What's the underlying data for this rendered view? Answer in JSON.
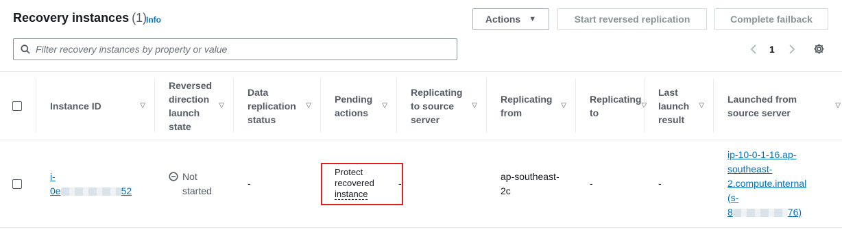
{
  "header": {
    "title": "Recovery instances",
    "count": "(1)",
    "info": "Info",
    "actions_label": "Actions",
    "reverse_label": "Start reversed replication",
    "failback_label": "Complete failback"
  },
  "search": {
    "placeholder": "Filter recovery instances by property or value"
  },
  "pagination": {
    "current_page": "1"
  },
  "table": {
    "columns": [
      "Instance ID",
      "Reversed direction launch state",
      "Data replication status",
      "Pending actions",
      "Replicating to source server",
      "Replicating from",
      "Replicating to",
      "Last launch result",
      "Launched from source server"
    ],
    "rows": [
      {
        "instance_id_prefix": "i-",
        "instance_id_start": "0e",
        "instance_id_end": "52",
        "reversed_state": "Not started",
        "data_replication_status": "-",
        "pending_actions": "Protect recovered instance",
        "pending_actions_line1": "Protect",
        "pending_actions_line2": "recovered",
        "pending_actions_line3": "instance",
        "replicating_to_source": "-",
        "replicating_from": "ap-southeast-2c",
        "replicating_from_line1": "ap-southeast-",
        "replicating_from_line2": "2c",
        "replicating_to": "-",
        "last_launch_result": "-",
        "launched_line1": "ip-10-0-1-16.ap-",
        "launched_line2": "southeast-",
        "launched_line3": "2.compute.internal",
        "launched_line4": "(s-",
        "launched_id_start": "8",
        "launched_id_end": "76)"
      }
    ]
  }
}
